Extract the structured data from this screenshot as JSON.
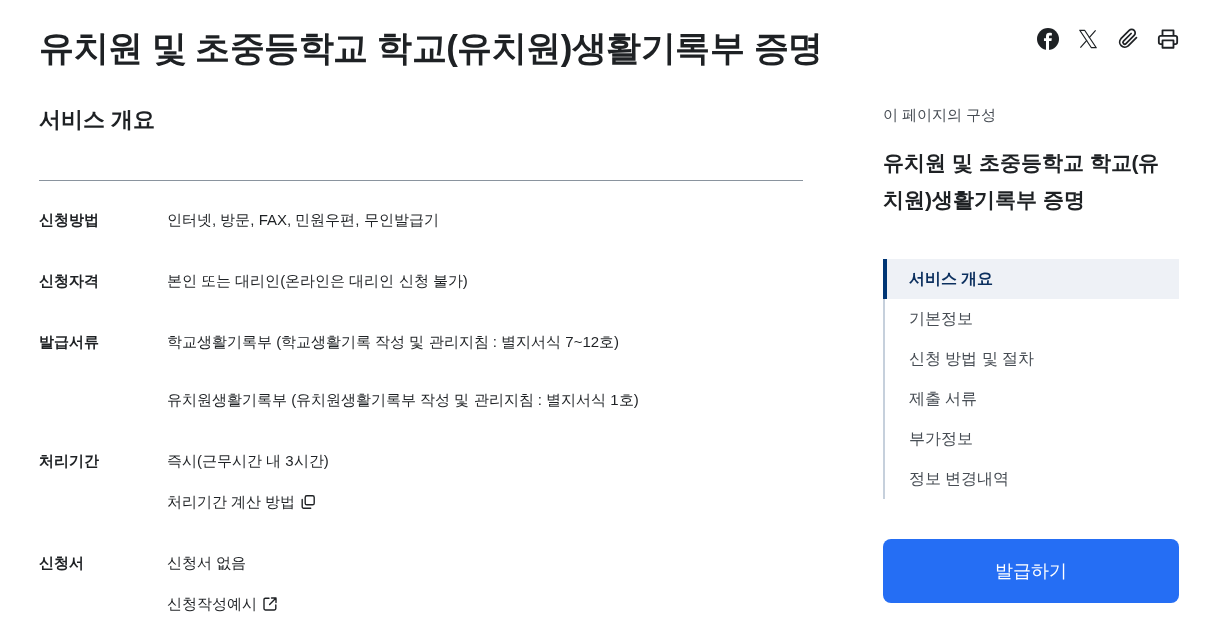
{
  "page": {
    "title": "유치원 및 초중등학교 학교(유치원)생활기록부 증명"
  },
  "overview": {
    "heading": "서비스 개요",
    "rows": [
      {
        "label": "신청방법",
        "values": [
          {
            "kind": "text",
            "text": "인터넷, 방문, FAX, 민원우편, 무인발급기"
          }
        ]
      },
      {
        "label": "신청자격",
        "values": [
          {
            "kind": "text",
            "text": "본인 또는 대리인(온라인은 대리인 신청 불가)"
          }
        ]
      },
      {
        "label": "발급서류",
        "values": [
          {
            "kind": "text",
            "text": "학교생활기록부 (학교생활기록 작성 및 관리지침 : 별지서식 7~12호)"
          },
          {
            "kind": "text",
            "text": "유치원생활기록부 (유치원생활기록부 작성 및 관리지침 : 별지서식 1호)"
          }
        ]
      },
      {
        "label": "처리기간",
        "values": [
          {
            "kind": "text",
            "text": "즉시(근무시간 내 3시간)"
          },
          {
            "kind": "popup-link",
            "text": "처리기간 계산 방법"
          }
        ]
      },
      {
        "label": "신청서",
        "values": [
          {
            "kind": "text",
            "text": "신청서 없음"
          },
          {
            "kind": "external-link",
            "text": "신청작성예시"
          }
        ]
      }
    ]
  },
  "toc": {
    "caption": "이 페이지의 구성",
    "title": "유치원 및 초중등학교 학교(유치원)생활기록부 증명",
    "items": [
      {
        "label": "서비스 개요",
        "selected": true
      },
      {
        "label": "기본정보",
        "selected": false
      },
      {
        "label": "신청 방법 및 절차",
        "selected": false
      },
      {
        "label": "제출 서류",
        "selected": false
      },
      {
        "label": "부가정보",
        "selected": false
      },
      {
        "label": "정보 변경내역",
        "selected": false
      }
    ]
  },
  "apply_button": {
    "label": "발급하기"
  }
}
